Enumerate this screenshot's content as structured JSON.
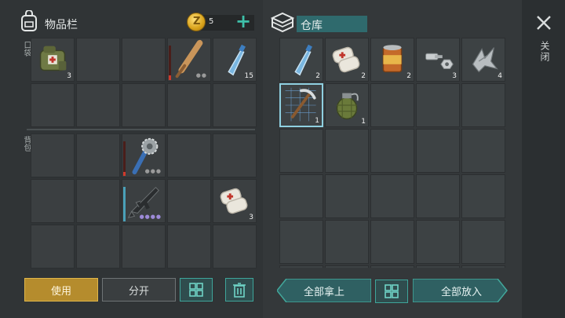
{
  "header": {
    "inventory_title": "物品栏",
    "coins": "5",
    "coin_symbol": "Z",
    "storage_title": "仓库",
    "close_label": "关闭"
  },
  "sections": {
    "pocket_label": "口袋",
    "backpack_label": "背包"
  },
  "inventory_slots": [
    {
      "slot": 1,
      "item": "first-aid-bag",
      "count": "3"
    },
    {
      "slot": 4,
      "item": "baseball-bat",
      "durability": "low"
    },
    {
      "slot": 5,
      "item": "water-bottle",
      "count": "15"
    },
    {
      "slot": 13,
      "item": "spiked-club",
      "durability": "low"
    },
    {
      "slot": 18,
      "item": "assault-rifle",
      "durability": "full",
      "grade_dots": 4
    },
    {
      "slot": 20,
      "item": "bandage",
      "count": "3"
    }
  ],
  "storage_slots": [
    {
      "slot": 1,
      "item": "water-bottle",
      "count": "2"
    },
    {
      "slot": 2,
      "item": "bandage",
      "count": "2"
    },
    {
      "slot": 3,
      "item": "canned-food",
      "count": "2"
    },
    {
      "slot": 4,
      "item": "nuts-bolts",
      "count": "3"
    },
    {
      "slot": 5,
      "item": "metal-scrap",
      "count": "4"
    },
    {
      "slot": 6,
      "item": "blueprint-pickaxe",
      "count": "1",
      "selected": true
    },
    {
      "slot": 7,
      "item": "grenade",
      "count": "1"
    }
  ],
  "buttons": {
    "use": "使用",
    "split": "分开",
    "take_all": "全部拿上",
    "put_all": "全部放入"
  },
  "colors": {
    "accent_teal": "#3ea59a",
    "use_gold": "#b58c2d",
    "selected_blue": "#3d6fa0"
  }
}
